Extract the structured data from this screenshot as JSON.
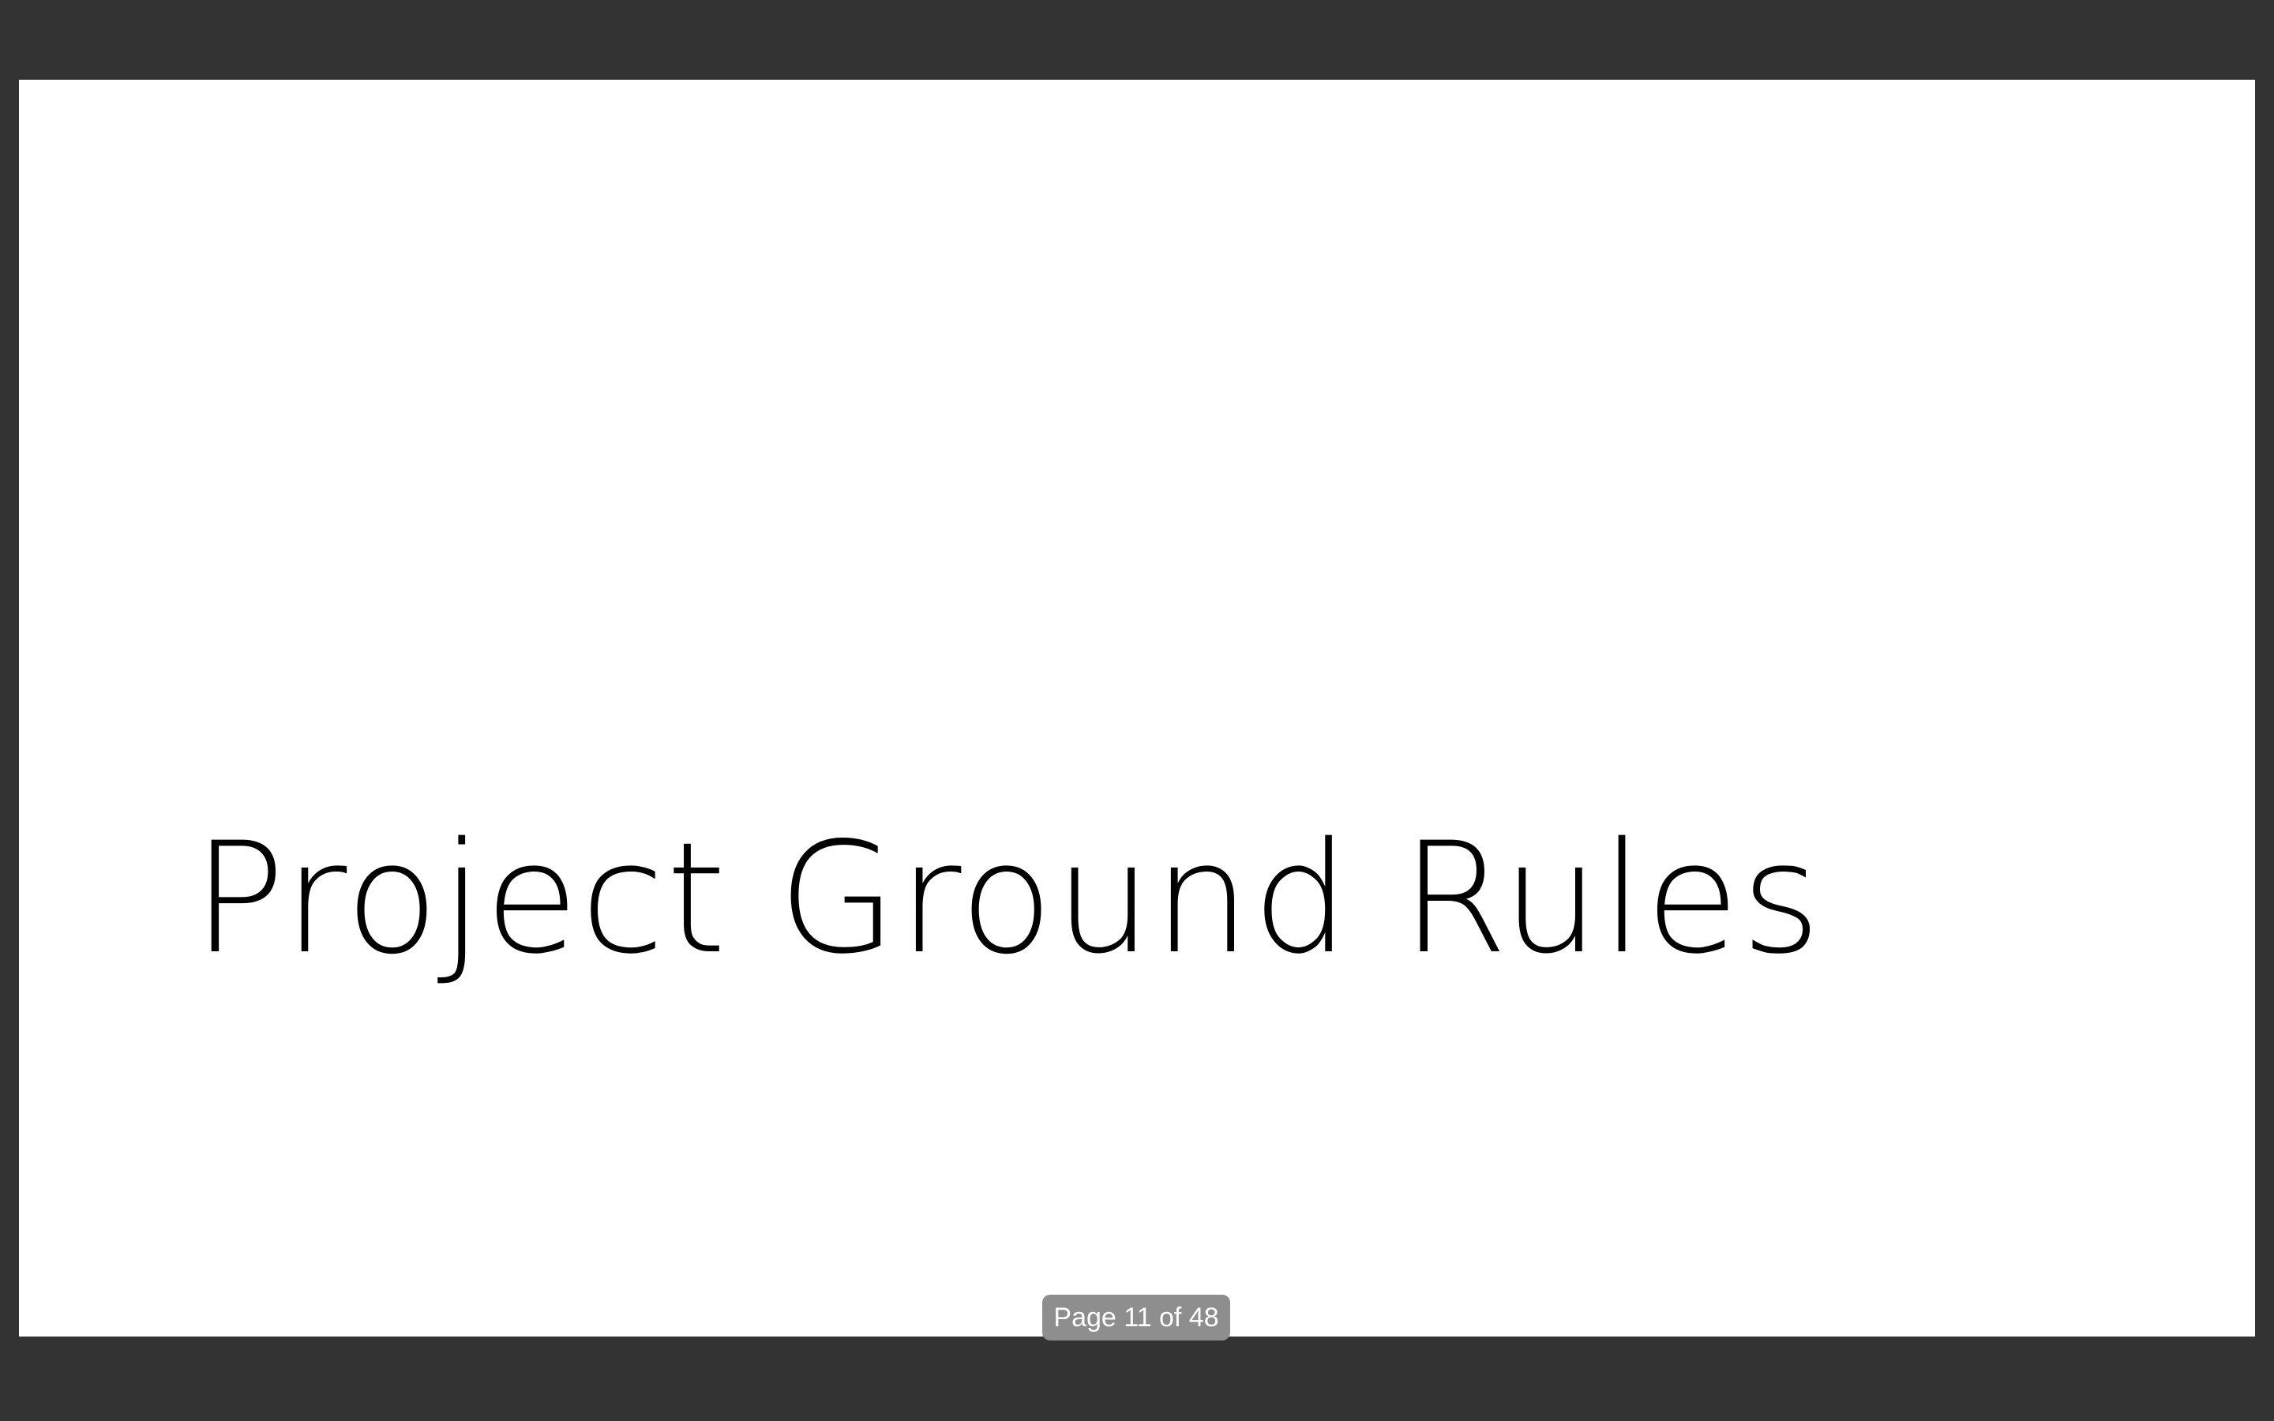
{
  "slide": {
    "title": "Project Ground Rules"
  },
  "pager": {
    "label": "Page 11 of 48",
    "current_page": 11,
    "total_pages": 48
  },
  "colors": {
    "viewer_background": "#333333",
    "slide_background": "#ffffff",
    "title_text": "#000000",
    "pager_background": "#8e8e8e",
    "pager_text": "#ffffff"
  }
}
